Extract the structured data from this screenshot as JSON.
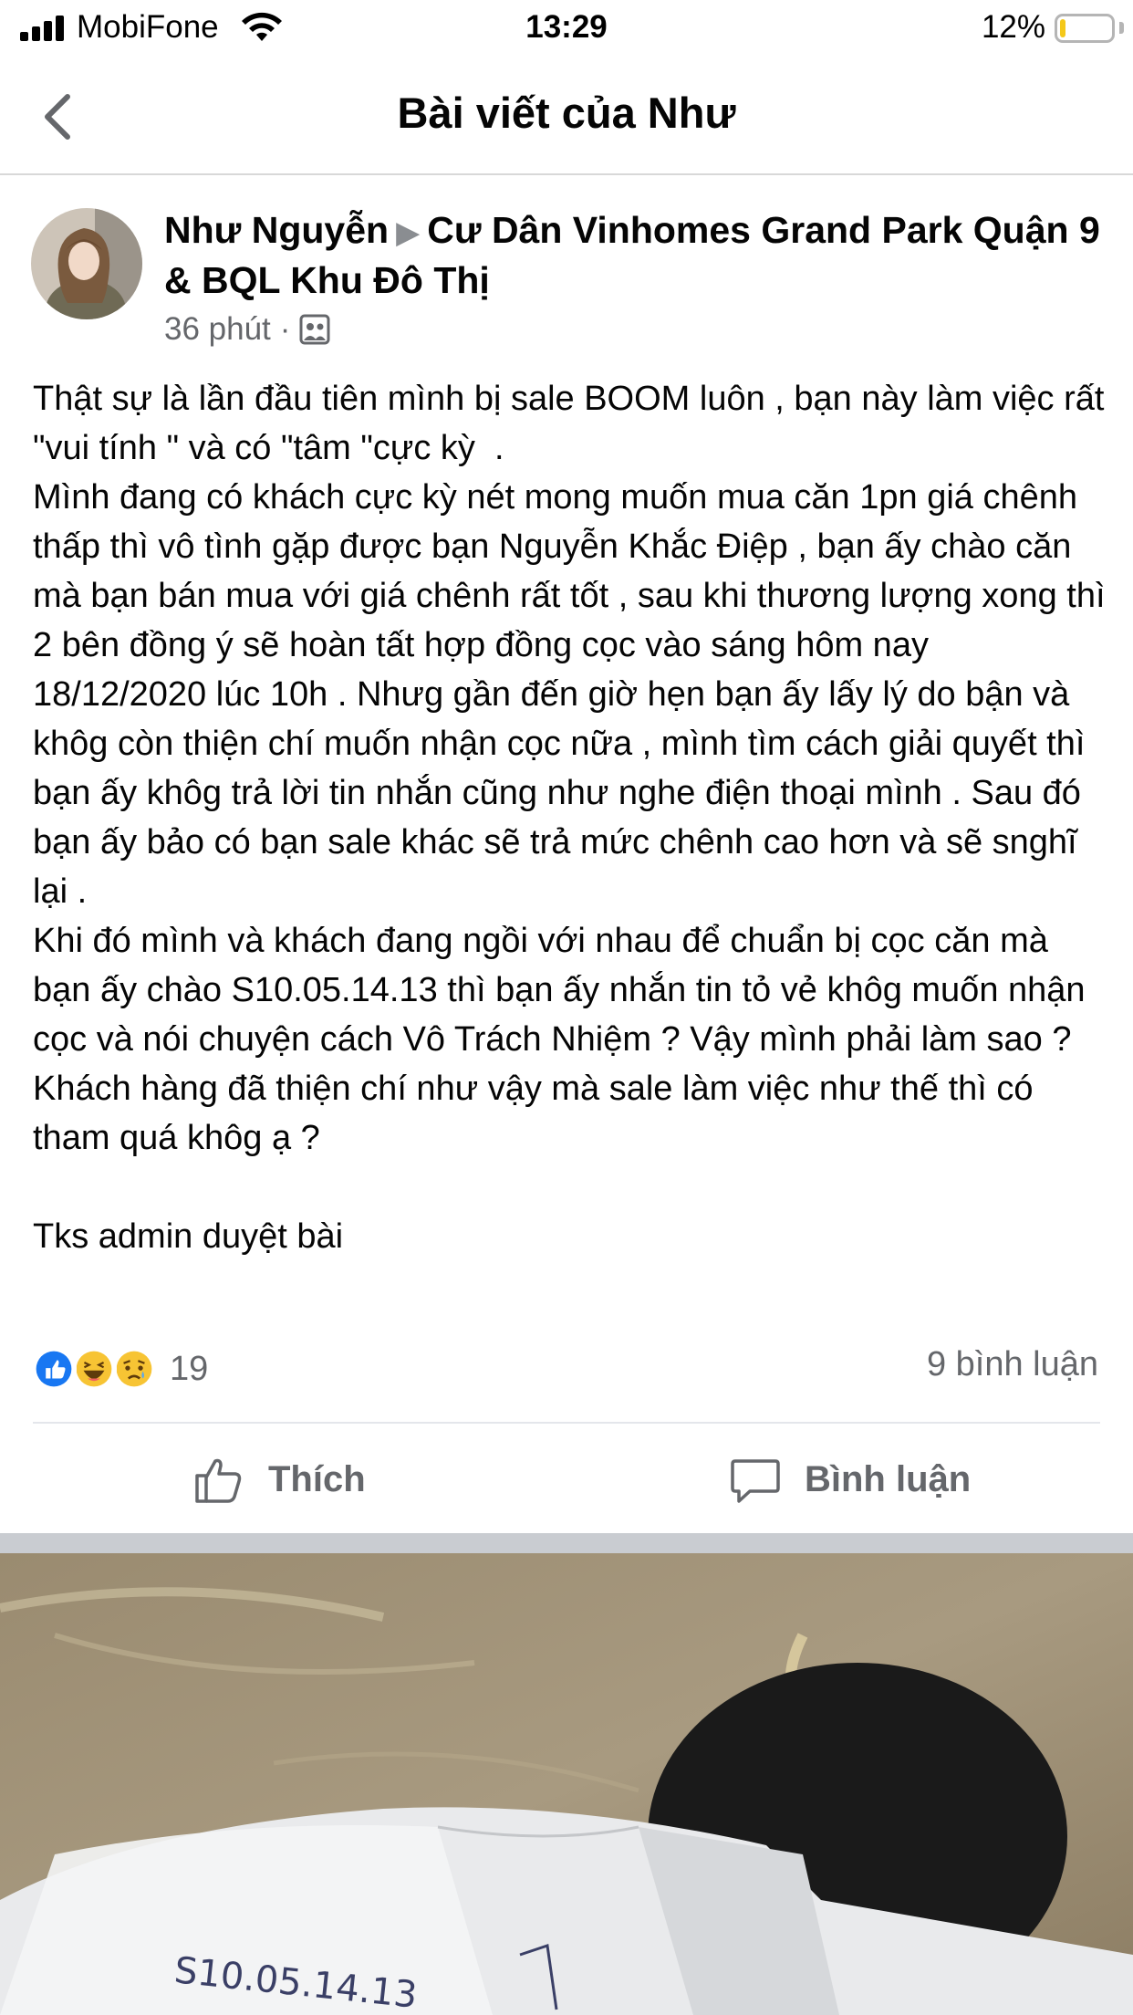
{
  "status_bar": {
    "carrier": "MobiFone",
    "time": "13:29",
    "battery_percent": "12%",
    "battery_level": 0.12
  },
  "header": {
    "title": "Bài viết của Như"
  },
  "post": {
    "author": "Như Nguyễn",
    "group": "Cư Dân Vinhomes Grand Park Quận 9 & BQL Khu Đô Thị",
    "time": "36 phút",
    "paragraphs": [
      "Thật sự là lần đầu tiên mình bị sale BOOM luôn , bạn này làm việc rất \"vui tính \" và có \"tâm \"cực kỳ  .",
      "Mình đang có khách cực kỳ nét mong muốn mua căn 1pn giá chênh thấp thì vô tình gặp được bạn Nguyễn Khắc Điệp , bạn ấy chào căn mà bạn bán mua với giá chênh rất tốt , sau khi thương lượng xong thì 2 bên đồng ý sẽ hoàn tất hợp đồng cọc vào sáng hôm nay 18/12/2020 lúc 10h . Nhưg gần đến giờ hẹn bạn ấy lấy lý do bận và khôg còn thiện chí muốn nhận cọc nữa , mình tìm cách giải quyết thì bạn ấy khôg trả lời tin nhắn cũng như nghe điện thoại mình . Sau đó bạn ấy bảo có bạn sale khác sẽ trả mức chênh cao hơn và sẽ snghĩ lại .",
      "Khi đó mình và khách đang ngồi với nhau để chuẩn bị cọc căn mà bạn ấy chào S10.05.14.13 thì bạn ấy nhắn tin tỏ vẻ khôg muốn nhận cọc và nói chuyện cách Vô Trách Nhiệm ? Vậy mình phải làm sao ? Khách hàng đã thiện chí như vậy mà sale làm việc như thế thì có tham quá khôg ạ ?",
      "",
      "Tks admin duyệt bài"
    ],
    "reaction_count": "19",
    "reactions": [
      "like-icon",
      "haha-icon",
      "sad-icon"
    ],
    "comment_count": "9 bình luận",
    "actions": {
      "like": "Thích",
      "comment": "Bình luận"
    },
    "photo_text": "S10.05.14.13"
  }
}
